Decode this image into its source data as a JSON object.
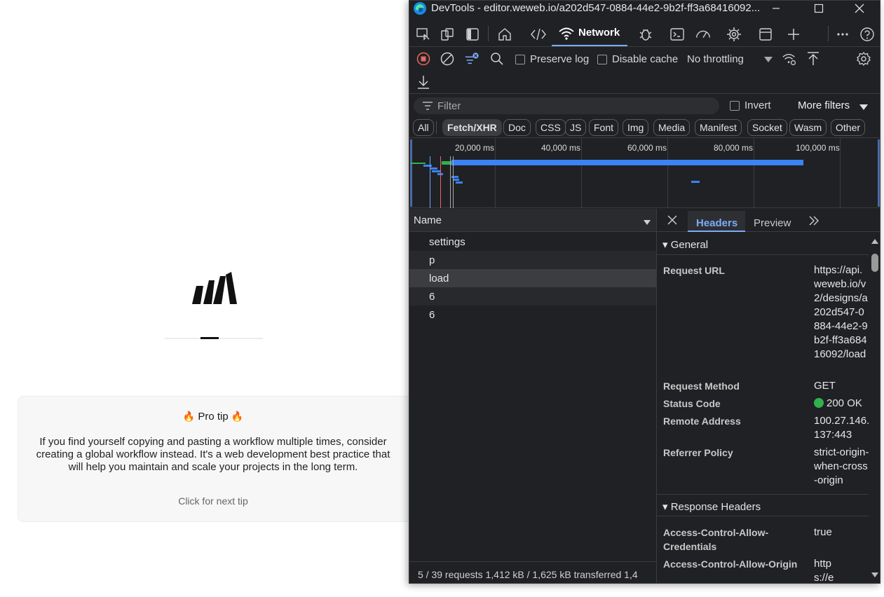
{
  "page": {
    "tip": {
      "title": "Pro tip",
      "body": "If you find yourself copying and pasting a workflow multiple times, consider creating a global workflow instead. It's a web development best practice that will help you maintain and scale your projects in the long term.",
      "next": "Click for next tip"
    }
  },
  "devtools": {
    "title": "DevTools - editor.weweb.io/a202d547-0884-44e2-9b2f-ff3a68416092...",
    "tabs": {
      "network": "Network"
    },
    "toolbar": {
      "preserve_log": "Preserve log",
      "disable_cache": "Disable cache",
      "throttling": "No throttling"
    },
    "filter": {
      "placeholder": "Filter",
      "invert": "Invert",
      "more_filters": "More filters"
    },
    "type_filters": [
      "All",
      "Fetch/XHR",
      "Doc",
      "CSS",
      "JS",
      "Font",
      "Img",
      "Media",
      "Manifest",
      "Socket",
      "Wasm",
      "Other"
    ],
    "overview_ticks": [
      "20,000 ms",
      "40,000 ms",
      "60,000 ms",
      "80,000 ms",
      "100,000 ms"
    ],
    "requests": {
      "column": "Name",
      "rows": [
        "settings",
        "p",
        "load",
        "6",
        "6"
      ],
      "summary": "5 / 39 requests   1,412 kB / 1,625 kB transferred   1,4"
    },
    "detail": {
      "tabs": {
        "headers": "Headers",
        "preview": "Preview"
      },
      "general": {
        "title": "General",
        "request_url_key": "Request URL",
        "request_url": "https://api.weweb.io/v2/designs/a202d547-0884-44e2-9b2f-ff3a68416092/load",
        "method_key": "Request Method",
        "method": "GET",
        "status_key": "Status Code",
        "status": "200 OK",
        "remote_key": "Remote Address",
        "remote": "100.27.146.137:443",
        "referrer_key": "Referrer Policy",
        "referrer": "strict-origin-when-cross-origin"
      },
      "response": {
        "title": "Response Headers",
        "acac_key": "Access-Control-Allow-Credentials",
        "acac": "true",
        "acao_key": "Access-Control-Allow-Origin",
        "acao": "https://e"
      }
    }
  },
  "colors": {
    "accent": "#7cacf8",
    "record": "#e46962",
    "status_ok": "#2fb24c",
    "waterfall_bar": "#3b82f6"
  }
}
